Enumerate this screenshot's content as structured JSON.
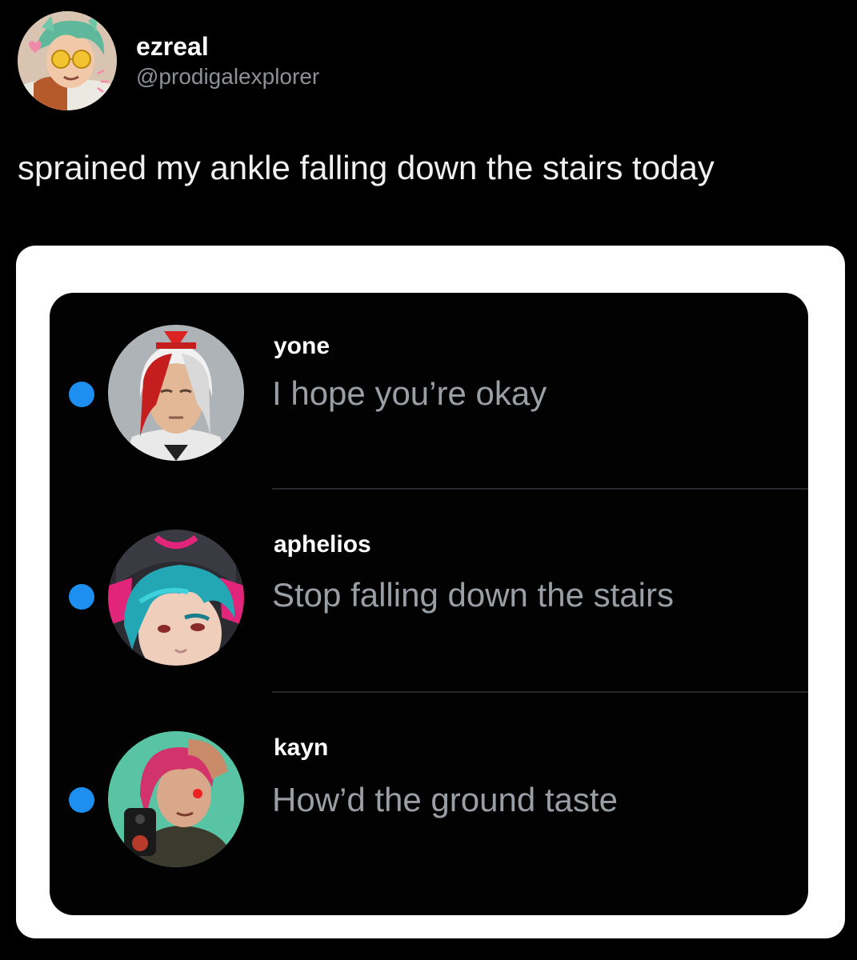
{
  "post": {
    "author": {
      "display_name": "ezreal",
      "handle": "@prodigalexplorer",
      "avatar_icon": "ezreal-avatar-icon"
    },
    "text": "sprained my ankle falling down the stairs today"
  },
  "inbox": {
    "unread_color": "#1d8ff0",
    "messages": [
      {
        "sender": "yone",
        "preview": "I hope you’re okay",
        "unread": true,
        "avatar_icon": "yone-avatar-icon"
      },
      {
        "sender": "aphelios",
        "preview": "Stop falling down the stairs",
        "unread": true,
        "avatar_icon": "aphelios-avatar-icon"
      },
      {
        "sender": "kayn",
        "preview": "How’d the ground taste",
        "unread": true,
        "avatar_icon": "kayn-avatar-icon"
      }
    ]
  }
}
